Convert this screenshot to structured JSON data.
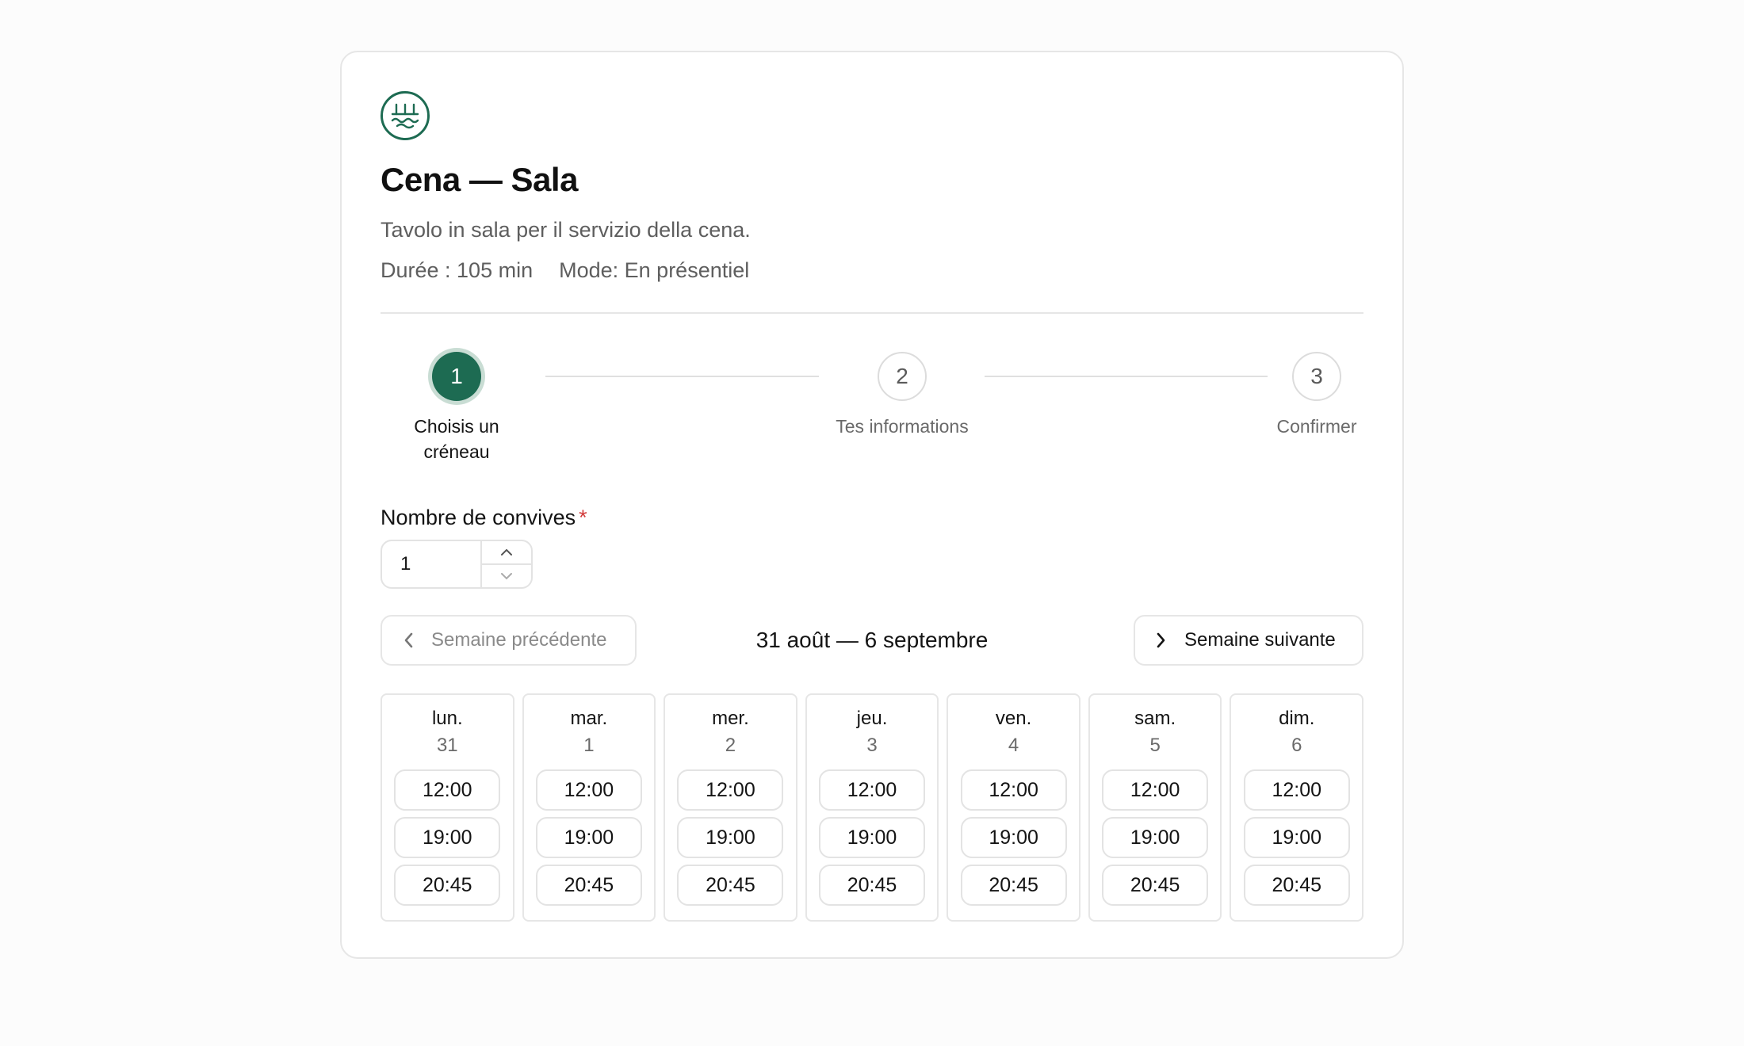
{
  "service": {
    "logo_icon": "restaurant-waves-icon",
    "title": "Cena — Sala",
    "description": "Tavolo in sala per il servizio della cena.",
    "duration": "Durée : 105 min",
    "mode": "Mode: En présentiel"
  },
  "steps": [
    {
      "number": "1",
      "label": "Choisis un créneau",
      "active": true
    },
    {
      "number": "2",
      "label": "Tes informations",
      "active": false
    },
    {
      "number": "3",
      "label": "Confirmer",
      "active": false
    }
  ],
  "guests": {
    "label": "Nombre de convives",
    "required_mark": "*",
    "value": "1"
  },
  "week": {
    "prev_label": "Semaine précédente",
    "range": "31 août — 6 septembre",
    "next_label": "Semaine suivante"
  },
  "days": [
    {
      "name": "lun.",
      "num": "31",
      "slots": [
        "12:00",
        "19:00",
        "20:45"
      ]
    },
    {
      "name": "mar.",
      "num": "1",
      "slots": [
        "12:00",
        "19:00",
        "20:45"
      ]
    },
    {
      "name": "mer.",
      "num": "2",
      "slots": [
        "12:00",
        "19:00",
        "20:45"
      ]
    },
    {
      "name": "jeu.",
      "num": "3",
      "slots": [
        "12:00",
        "19:00",
        "20:45"
      ]
    },
    {
      "name": "ven.",
      "num": "4",
      "slots": [
        "12:00",
        "19:00",
        "20:45"
      ]
    },
    {
      "name": "sam.",
      "num": "5",
      "slots": [
        "12:00",
        "19:00",
        "20:45"
      ]
    },
    {
      "name": "dim.",
      "num": "6",
      "slots": [
        "12:00",
        "19:00",
        "20:45"
      ]
    }
  ],
  "colors": {
    "accent": "#1d6b52",
    "required": "#d23b3b"
  }
}
